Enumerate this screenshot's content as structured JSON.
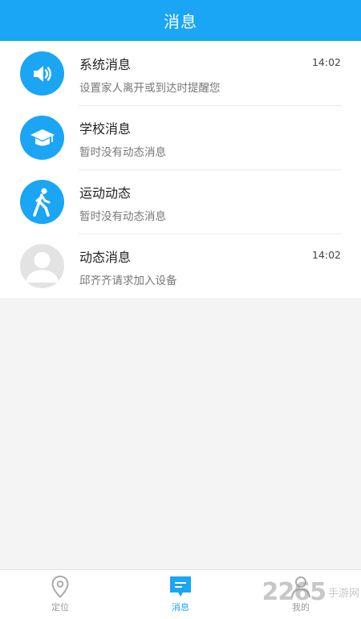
{
  "header": {
    "title": "消息"
  },
  "messages": [
    {
      "title": "系统消息",
      "subtitle": "设置家人离开或到达时提醒您",
      "time": "14:02",
      "icon": "speaker-icon"
    },
    {
      "title": "学校消息",
      "subtitle": "暂时没有动态消息",
      "time": "",
      "icon": "graduation-cap-icon"
    },
    {
      "title": "运动动态",
      "subtitle": "暂时没有动态消息",
      "time": "",
      "icon": "walking-person-icon"
    },
    {
      "title": "动态消息",
      "subtitle": "邱齐齐请求加入设备",
      "time": "14:02",
      "icon": "user-avatar-icon"
    }
  ],
  "tabs": [
    {
      "label": "定位",
      "icon": "location-pin-icon",
      "active": false
    },
    {
      "label": "消息",
      "icon": "message-icon",
      "active": true
    },
    {
      "label": "我的",
      "icon": "profile-icon",
      "active": false
    }
  ],
  "watermark": {
    "number": "2265",
    "text": "手游网"
  },
  "colors": {
    "primary": "#1aa5f5",
    "background": "#f4f4f4",
    "inactive": "#999999"
  }
}
